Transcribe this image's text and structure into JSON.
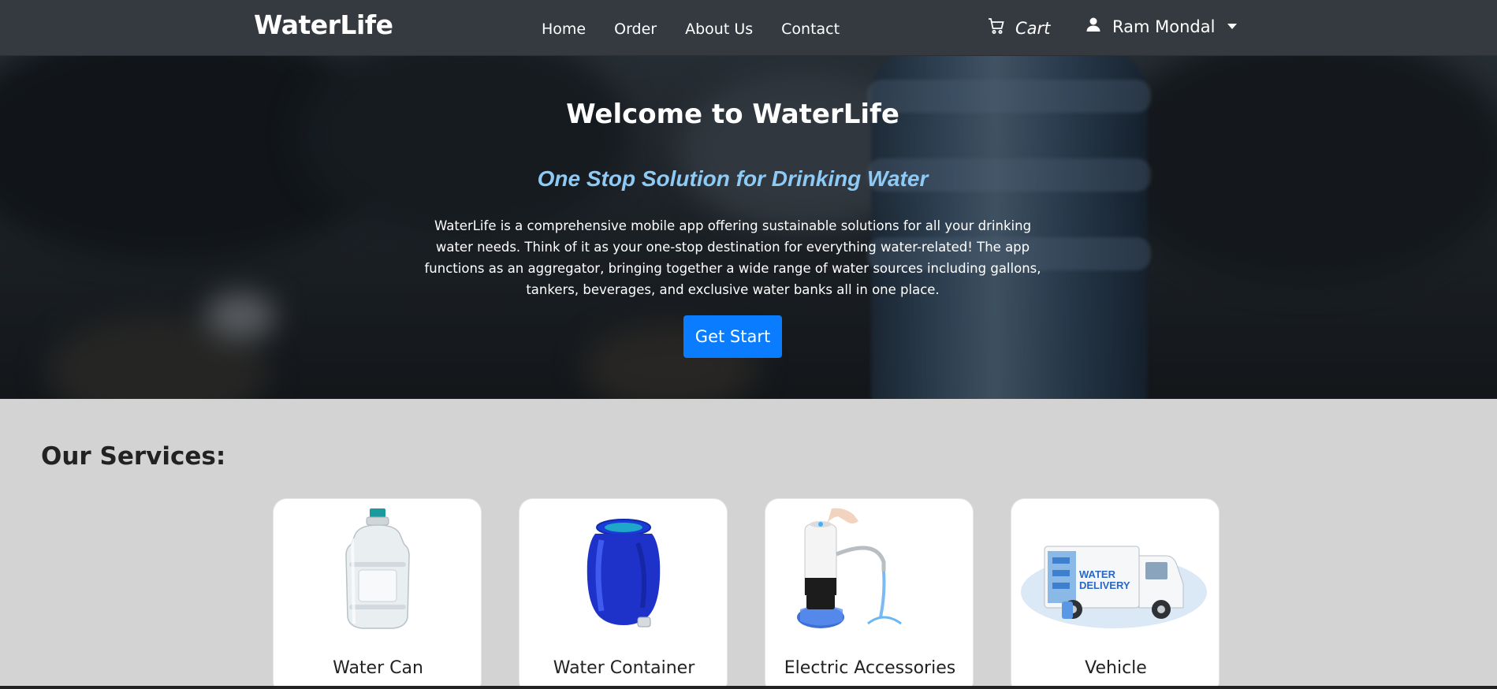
{
  "navbar": {
    "brand": "WaterLife",
    "links": [
      "Home",
      "Order",
      "About Us",
      "Contact"
    ],
    "cart_label": "Cart",
    "user_label": "Ram Mondal"
  },
  "hero": {
    "title": "Welcome to WaterLife",
    "subtitle": "One Stop Solution for Drinking Water",
    "description": "WaterLife is a comprehensive mobile app offering sustainable solutions for all your drinking water needs. Think of it as your one-stop destination for everything water-related! The app functions as an aggregator, bringing together a wide range of water sources including gallons, tankers, beverages, and exclusive water banks all in one place.",
    "button_label": "Get Start"
  },
  "services": {
    "title": "Our Services:",
    "cards": [
      {
        "label": "Water Can"
      },
      {
        "label": "Water Container"
      },
      {
        "label": "Electric Accessories"
      },
      {
        "label": "Vehicle",
        "image_text_1": "WATER",
        "image_text_2": "DELIVERY"
      }
    ]
  },
  "colors": {
    "navbar_bg": "#343a40",
    "accent": "#0a7cff",
    "subtitle": "#8ecaf6",
    "page_bg": "#d3d3d3"
  }
}
